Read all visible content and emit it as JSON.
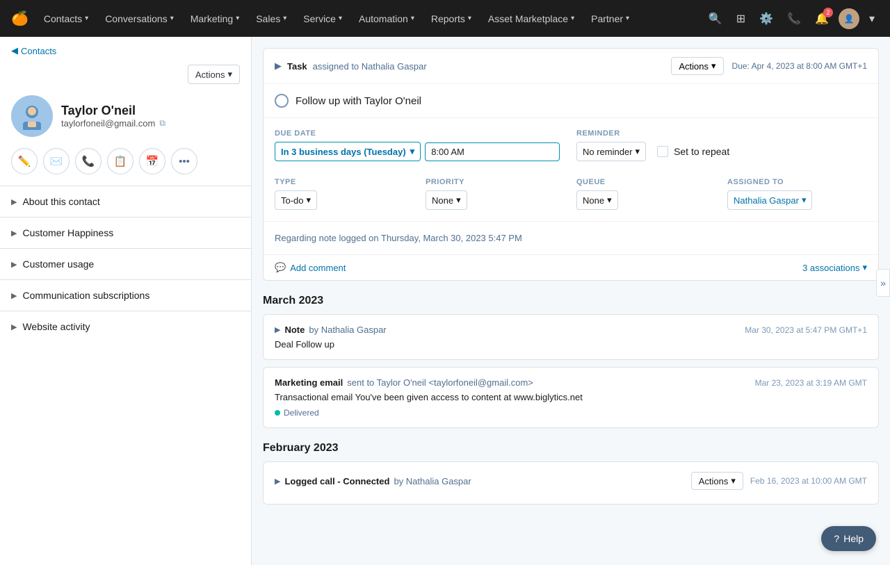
{
  "topnav": {
    "logo": "🍊",
    "items": [
      {
        "label": "Contacts",
        "caret": true
      },
      {
        "label": "Conversations",
        "caret": true
      },
      {
        "label": "Marketing",
        "caret": true
      },
      {
        "label": "Sales",
        "caret": true
      },
      {
        "label": "Service",
        "caret": true
      },
      {
        "label": "Automation",
        "caret": true
      },
      {
        "label": "Reports",
        "caret": true
      },
      {
        "label": "Asset Marketplace",
        "caret": true
      },
      {
        "label": "Partner",
        "caret": true
      }
    ]
  },
  "sidebar": {
    "contacts_link": "Contacts",
    "actions_btn": "Actions",
    "contact": {
      "name": "Taylor O'neil",
      "email": "taylorfoneil@gmail.com",
      "avatar": "👤"
    },
    "action_buttons": [
      {
        "icon": "✏️",
        "label": "Note"
      },
      {
        "icon": "✉️",
        "label": "Email"
      },
      {
        "icon": "📞",
        "label": "Call"
      },
      {
        "icon": "📋",
        "label": "Task"
      },
      {
        "icon": "📅",
        "label": "Schedule"
      },
      {
        "icon": "•••",
        "label": "More"
      }
    ],
    "sections": [
      {
        "label": "About this contact"
      },
      {
        "label": "Customer Happiness"
      },
      {
        "label": "Customer usage"
      },
      {
        "label": "Communication subscriptions"
      },
      {
        "label": "Website activity"
      }
    ]
  },
  "task": {
    "header": {
      "prefix": "Task",
      "assigned": "assigned to Nathalia Gaspar",
      "actions_btn": "Actions",
      "caret": "▾",
      "due_label": "Due: Apr 4, 2023 at 8:00 AM GMT+1"
    },
    "title": "Follow up with Taylor O'neil",
    "due_date_label": "Due date",
    "due_date_value": "In 3 business days (Tuesday)",
    "due_time": "8:00 AM",
    "reminder_label": "Reminder",
    "reminder_value": "No reminder",
    "set_to_repeat": "Set to repeat",
    "type_label": "Type",
    "type_value": "To-do",
    "priority_label": "Priority",
    "priority_value": "None",
    "queue_label": "Queue",
    "queue_value": "None",
    "assigned_label": "Assigned to",
    "assigned_value": "Nathalia Gaspar",
    "note": "Regarding note logged on Thursday, March 30, 2023 5:47 PM",
    "add_comment": "Add comment",
    "associations": "3 associations",
    "associations_caret": "▾"
  },
  "timeline": {
    "march_label": "March 2023",
    "february_label": "February 2023",
    "note_item": {
      "type": "Note",
      "by": "by Nathalia Gaspar",
      "time": "Mar 30, 2023 at 5:47 PM GMT+1",
      "body": "Deal Follow up"
    },
    "email_item": {
      "type": "Marketing email",
      "sent_to": "sent to Taylor O'neil <taylorfoneil@gmail.com>",
      "time": "Mar 23, 2023 at 3:19 AM GMT",
      "body": "Transactional email You've been given access to content at www.biglytics.net",
      "status": "Delivered"
    },
    "call_item": {
      "type": "Logged call - Connected",
      "by": "by Nathalia Gaspar",
      "time": "Feb 16, 2023 at 10:00 AM GMT",
      "actions_btn": "Actions",
      "actions_caret": "▾"
    }
  },
  "help_btn": "Help",
  "collapse_icon": "»"
}
